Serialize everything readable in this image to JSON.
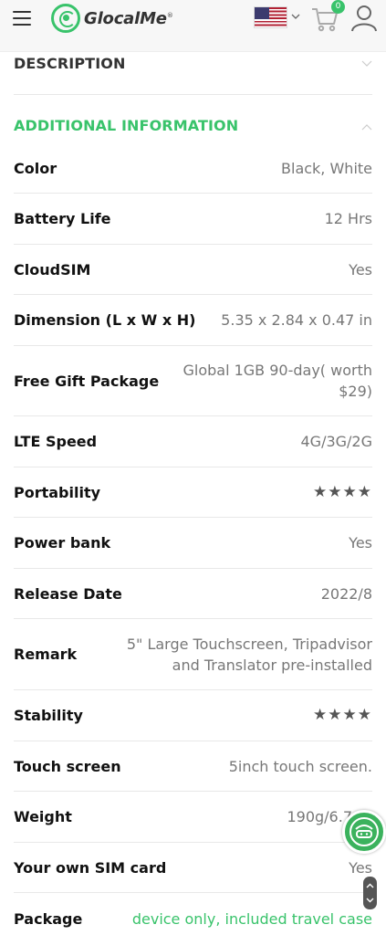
{
  "header": {
    "brand": "GlocalMe",
    "brand_mark": "®",
    "cart_count": "0",
    "icons": [
      "hamburger-menu-icon",
      "globe-logo-icon",
      "us-flag-icon",
      "chevron-down-icon",
      "cart-icon",
      "user-icon"
    ]
  },
  "sections": {
    "description": "DESCRIPTION",
    "additional": "ADDITIONAL INFORMATION"
  },
  "colors": {
    "accent": "#39c36b",
    "label": "#111111",
    "value": "#777777"
  },
  "specs": [
    {
      "label": "Color",
      "value": "Black, White"
    },
    {
      "label": "Battery Life",
      "value": "12 Hrs"
    },
    {
      "label": "CloudSIM",
      "value": "Yes"
    },
    {
      "label": "Dimension (L x W x H)",
      "value": "5.35 x 2.84 x 0.47 in"
    },
    {
      "label": "Free Gift Package",
      "value": "Global 1GB 90-day( worth $29)"
    },
    {
      "label": "LTE Speed",
      "value": "4G/3G/2G"
    },
    {
      "label": "Portability",
      "value": "★★★★"
    },
    {
      "label": "Power bank",
      "value": "Yes"
    },
    {
      "label": "Release Date",
      "value": "2022/8"
    },
    {
      "label": "Remark",
      "value": "5\" Large Touchscreen, Tripadvisor and Translator pre-installed"
    },
    {
      "label": "Stability",
      "value": "★★★★"
    },
    {
      "label": "Touch screen",
      "value": "5inch touch screen."
    },
    {
      "label": "Weight",
      "value": "190g/6.7"
    },
    {
      "label": "Your own SIM card",
      "value": "Yes"
    },
    {
      "label": "Package",
      "value": "device only, included travel case"
    }
  ]
}
